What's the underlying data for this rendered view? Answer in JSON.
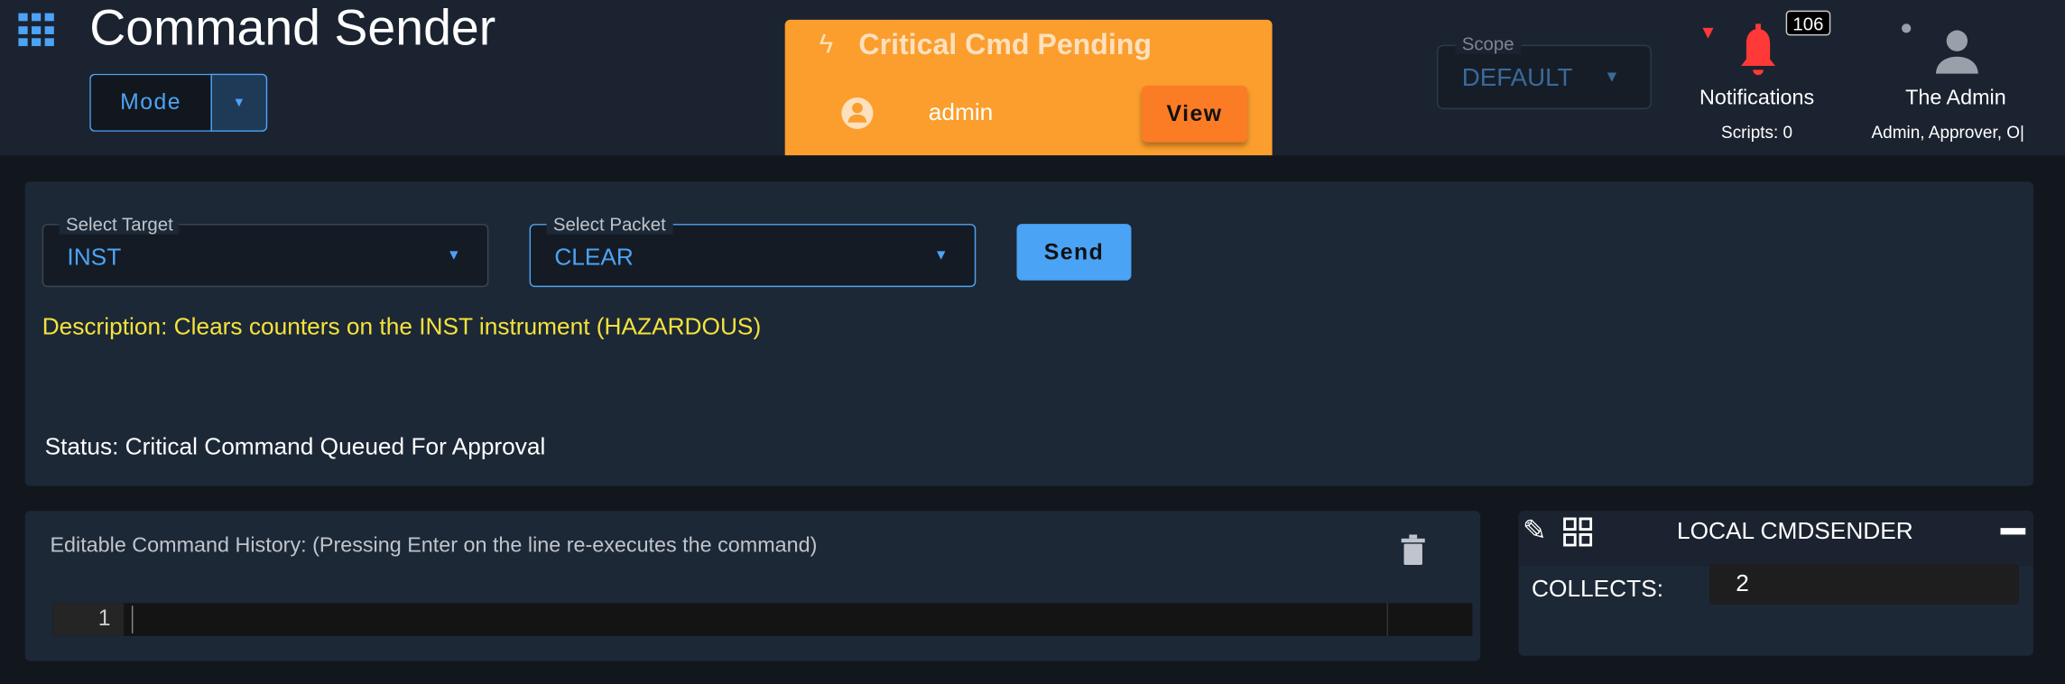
{
  "header": {
    "title": "Command Sender",
    "mode_label": "Mode",
    "scope": {
      "label": "Scope",
      "value": "DEFAULT"
    },
    "notifications": {
      "label": "Notifications",
      "count": "106",
      "sub": "Scripts: 0",
      "color": "#ff3838"
    },
    "user": {
      "name": "The Admin",
      "roles": "Admin, Approver, O|"
    }
  },
  "banner": {
    "title": "Critical Cmd Pending",
    "user": "admin",
    "view_label": "View",
    "color": "#fb9e2d"
  },
  "sender": {
    "target": {
      "label": "Select Target",
      "value": "INST"
    },
    "packet": {
      "label": "Select Packet",
      "value": "CLEAR"
    },
    "send_label": "Send",
    "description": "Description: Clears counters on the INST instrument (HAZARDOUS)",
    "status": "Status: Critical Command Queued For Approval"
  },
  "history": {
    "title": "Editable Command History: (Pressing Enter on the line re-executes the command)",
    "line_number": "1"
  },
  "local": {
    "title": "LOCAL CMDSENDER",
    "collects_label": "COLLECTS:",
    "collects_value": "2"
  }
}
